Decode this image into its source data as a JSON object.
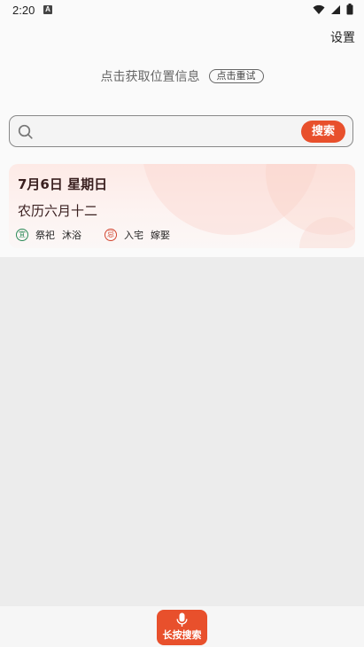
{
  "status_bar": {
    "time": "2:20",
    "app_icon_letter": "A",
    "icons": [
      "wifi-icon",
      "signal-icon",
      "battery-icon"
    ]
  },
  "header": {
    "settings_label": "设置"
  },
  "location": {
    "text": "点击获取位置信息",
    "retry_label": "点击重试"
  },
  "search": {
    "placeholder": "",
    "value": "",
    "button_label": "搜索",
    "accent_color": "#e8502c"
  },
  "date_card": {
    "solar_date": "7月6日 星期日",
    "lunar_date": "农历六月十二",
    "yi_badge": "宜",
    "yi_items": [
      "祭祀",
      "沐浴"
    ],
    "ji_badge": "忌",
    "ji_items": [
      "入宅",
      "嫁娶"
    ],
    "yi_color": "#2c8a58",
    "ji_color": "#d2452f"
  },
  "bottom": {
    "voice_button_label": "长按搜索",
    "voice_icon": "mic-icon"
  }
}
